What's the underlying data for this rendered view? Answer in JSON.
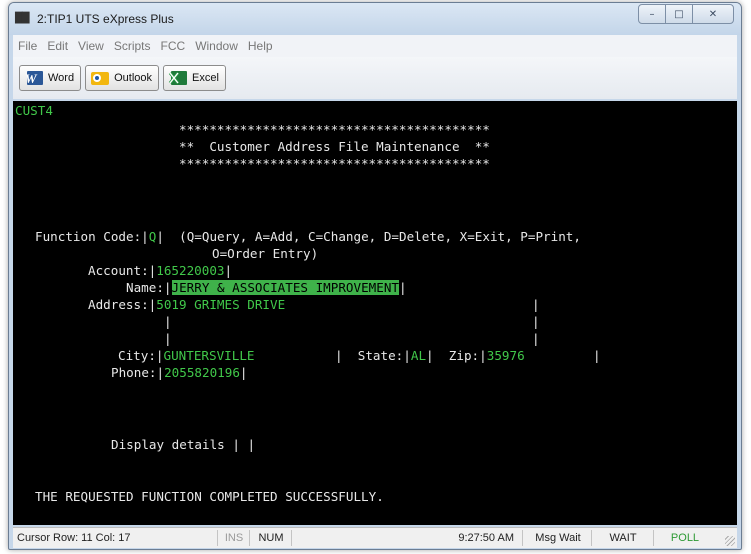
{
  "window": {
    "title": "2:TIP1 UTS eXpress Plus",
    "app_icon": "3270-terminal-icon",
    "minimize": "–",
    "maximize": "□",
    "close": "✕"
  },
  "menu": {
    "items": [
      {
        "label": "File"
      },
      {
        "label": "Edit"
      },
      {
        "label": "View"
      },
      {
        "label": "Scripts"
      },
      {
        "label": "FCC"
      },
      {
        "label": "Window"
      },
      {
        "label": "Help"
      }
    ]
  },
  "toolbar": {
    "word_label": "Word",
    "outlook_label": "Outlook",
    "excel_label": "Excel",
    "colors": {
      "word": "#2b5797",
      "outlook": "#f2b70f",
      "excel": "#1f7a3a"
    }
  },
  "screen": {
    "screen_id": "CUST4",
    "banner_top": "*****************************************",
    "banner_mid": "**  Customer Address File Maintenance  **",
    "banner_bottom": "*****************************************",
    "function_label": "Function Code:",
    "function_value": "Q",
    "function_help_1": "(Q=Query, A=Add, C=Change, D=Delete, X=Exit, P=Print,",
    "function_help_2": "O=Order Entry)",
    "account_label": "Account:",
    "account_value": "165220003",
    "name_label": "Name:",
    "name_value": "JERRY & ASSOCIATES IMPROVEMENT",
    "address_label": "Address:",
    "address_line_1": "5019 GRIMES DRIVE",
    "address_line_2": "",
    "address_line_3": "",
    "city_label": "City:",
    "city_value": "GUNTERSVILLE",
    "state_label": "State:",
    "state_value": "AL",
    "zip_label": "Zip:",
    "zip_value": "35976",
    "phone_label": "Phone:",
    "phone_value": "2055820196",
    "details_label": "Display details",
    "details_value": "",
    "message": "THE REQUESTED FUNCTION COMPLETED SUCCESSFULLY.",
    "field_delimiter": "|",
    "colors": {
      "background": "#000000",
      "text": "#e8e8e8",
      "field": "#41c84a",
      "highlight": "#3fb24a"
    }
  },
  "status": {
    "cursor": "Cursor Row: 11  Col: 17",
    "ins": "INS",
    "num": "NUM",
    "time": "9:27:50 AM",
    "msg_wait": "Msg Wait",
    "wait": "WAIT",
    "poll": "POLL"
  }
}
